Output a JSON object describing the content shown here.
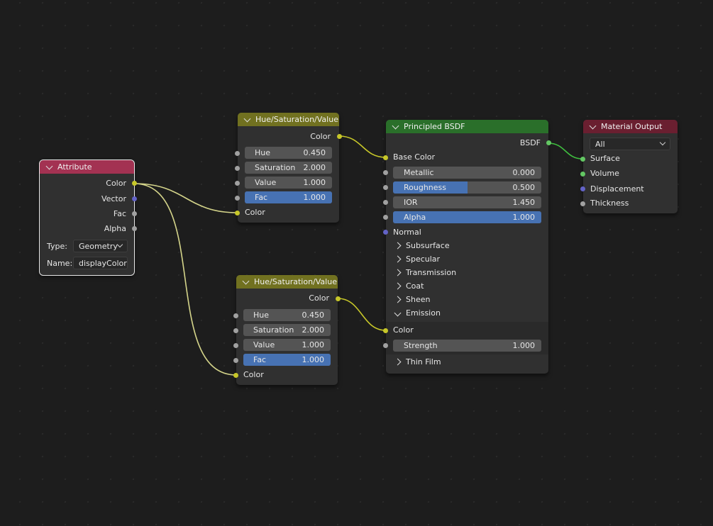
{
  "attribute": {
    "title": "Attribute",
    "header_color": "#a33252",
    "outputs": [
      "Color",
      "Vector",
      "Fac",
      "Alpha"
    ],
    "type_label": "Type:",
    "type_value": "Geometry",
    "name_label": "Name:",
    "name_value": "displayColor"
  },
  "hsv1": {
    "title": "Hue/Saturation/Value",
    "header_color": "#717120",
    "output": "Color",
    "fields": [
      {
        "label": "Hue",
        "value": "0.450"
      },
      {
        "label": "Saturation",
        "value": "2.000"
      },
      {
        "label": "Value",
        "value": "1.000"
      },
      {
        "label": "Fac",
        "value": "1.000",
        "fill": 1.0
      }
    ],
    "input": "Color"
  },
  "hsv2": {
    "title": "Hue/Saturation/Value",
    "header_color": "#717120",
    "output": "Color",
    "fields": [
      {
        "label": "Hue",
        "value": "0.450"
      },
      {
        "label": "Saturation",
        "value": "2.000"
      },
      {
        "label": "Value",
        "value": "1.000"
      },
      {
        "label": "Fac",
        "value": "1.000",
        "fill": 1.0
      }
    ],
    "input": "Color"
  },
  "bsdf": {
    "title": "Principled BSDF",
    "header_color": "#2a6f2a",
    "output": "BSDF",
    "base_color": "Base Color",
    "fields": [
      {
        "label": "Metallic",
        "value": "0.000",
        "fill": 0.0
      },
      {
        "label": "Roughness",
        "value": "0.500",
        "fill": 0.5
      },
      {
        "label": "IOR",
        "value": "1.450"
      },
      {
        "label": "Alpha",
        "value": "1.000",
        "fill": 1.0
      }
    ],
    "normal": "Normal",
    "panels": [
      "Subsurface",
      "Specular",
      "Transmission",
      "Coat",
      "Sheen"
    ],
    "emission": "Emission",
    "emission_color": "Color",
    "strength": {
      "label": "Strength",
      "value": "1.000"
    },
    "thin_film": "Thin Film"
  },
  "output": {
    "title": "Material Output",
    "header_color": "#6a1f30",
    "target": "All",
    "inputs": [
      "Surface",
      "Volume",
      "Displacement",
      "Thickness"
    ]
  },
  "colors": {
    "wire_color": "#d4d48a",
    "wire_shader": "#3fbf3f",
    "socket_color": "#c7c729",
    "socket_float": "#a1a1a1",
    "socket_vector": "#6363c7",
    "socket_shader": "#63c763",
    "field_fill": "#4772b3"
  }
}
